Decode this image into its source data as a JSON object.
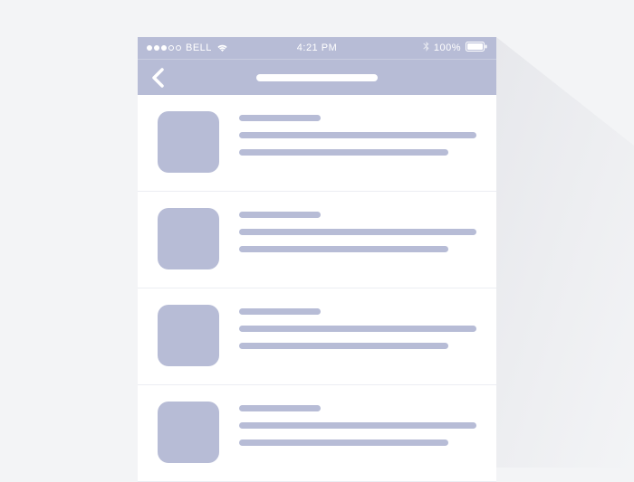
{
  "status": {
    "carrier": "BELL",
    "time": "4:21 PM",
    "battery_percent": "100%"
  },
  "colors": {
    "accent": "#b7bcd6",
    "background": "#f3f4f6"
  },
  "list_items": [
    {
      "title_ph": "",
      "line1_ph": "",
      "line2_ph": ""
    },
    {
      "title_ph": "",
      "line1_ph": "",
      "line2_ph": ""
    },
    {
      "title_ph": "",
      "line1_ph": "",
      "line2_ph": ""
    }
  ]
}
